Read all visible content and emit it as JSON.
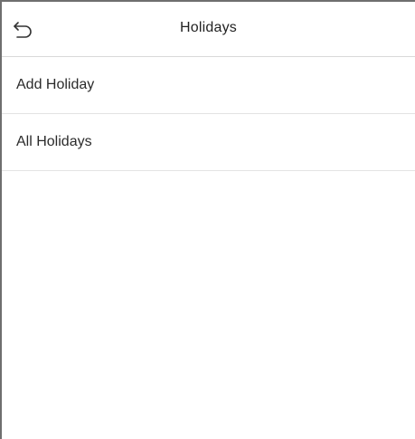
{
  "header": {
    "back_icon": "back-arrow-icon",
    "title": "Holidays"
  },
  "menu": {
    "items": [
      {
        "label": "Add Holiday"
      },
      {
        "label": "All Holidays"
      }
    ]
  },
  "colors": {
    "frame_border": "#6f6f6f",
    "divider": "#e3e3e3",
    "text": "#2b2b2b",
    "background": "#ffffff"
  }
}
